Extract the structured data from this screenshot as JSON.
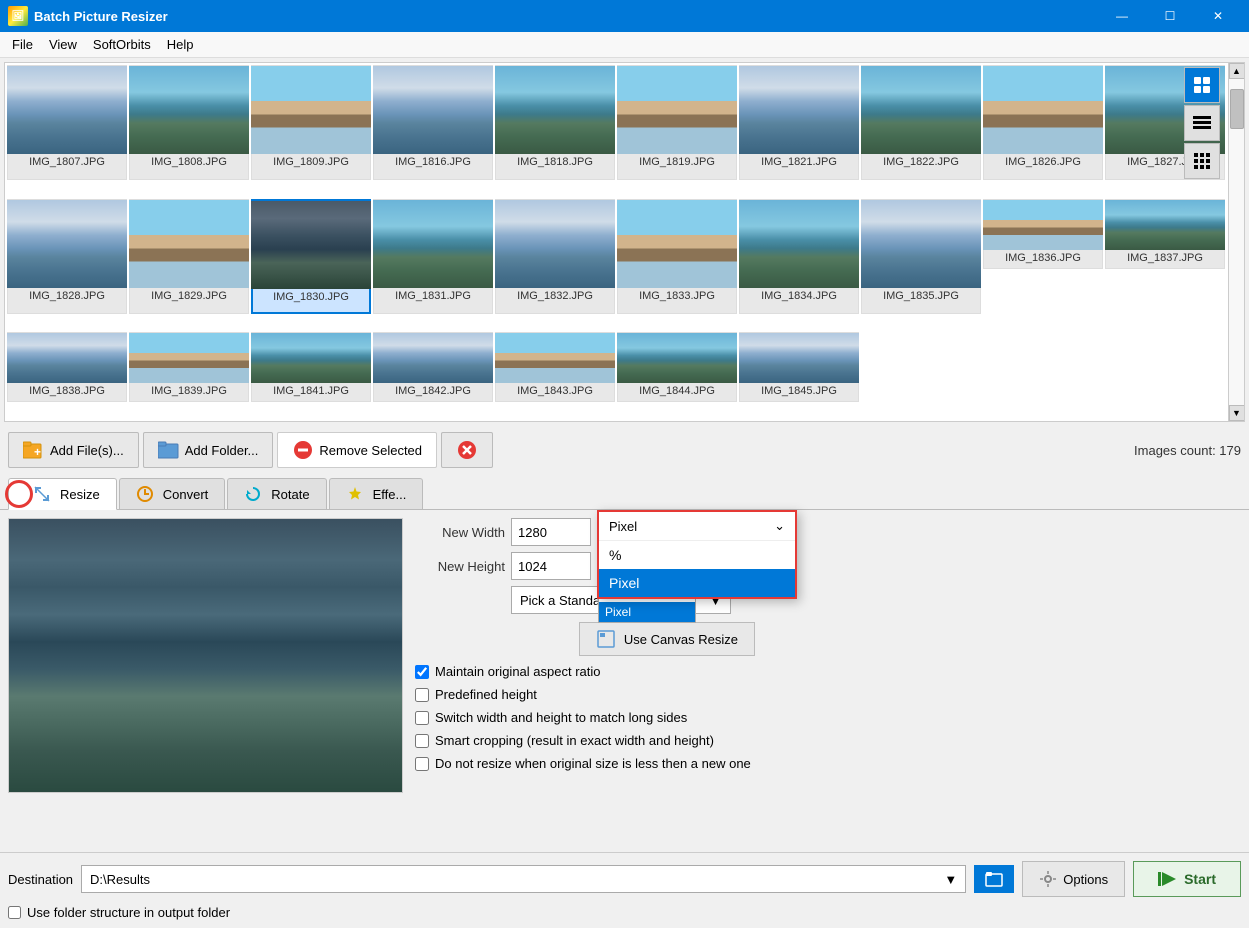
{
  "app": {
    "title": "Batch Picture Resizer",
    "icon": "🖼"
  },
  "titlebar": {
    "minimize": "—",
    "maximize": "☐",
    "close": "✕"
  },
  "menubar": {
    "items": [
      "File",
      "View",
      "SoftOrbits",
      "Help"
    ]
  },
  "toolbar": {
    "add_files_label": "Add File(s)...",
    "add_folder_label": "Add Folder...",
    "remove_selected_label": "Remove Selected",
    "images_count_label": "Images count: 179"
  },
  "tabs": {
    "resize_label": "Resize",
    "convert_label": "Convert",
    "rotate_label": "Rotate",
    "effects_label": "Effe..."
  },
  "resize": {
    "new_width_label": "New Width",
    "new_height_label": "New Height",
    "width_value": "1280",
    "height_value": "1024",
    "unit_options": [
      "%",
      "Pixel"
    ],
    "unit_selected": "Pixel",
    "standard_size_placeholder": "Pick a Standard Size",
    "maintain_aspect_label": "Maintain original aspect ratio",
    "maintain_aspect_checked": true,
    "predefined_height_label": "Predefined height",
    "predefined_height_checked": false,
    "switch_wh_label": "Switch width and height to match long sides",
    "switch_wh_checked": false,
    "smart_crop_label": "Smart cropping (result in exact width and height)",
    "smart_crop_checked": false,
    "no_resize_label": "Do not resize when original size is less then a new one",
    "no_resize_checked": false,
    "canvas_btn_label": "Use Canvas Resize"
  },
  "dropdown_popup": {
    "header": "Pixel",
    "options": [
      {
        "label": "%",
        "selected": false
      },
      {
        "label": "Pixel",
        "selected": true
      }
    ]
  },
  "bottom": {
    "destination_label": "Destination",
    "destination_value": "D:\\Results",
    "options_label": "Options",
    "start_label": "Start",
    "folder_structure_label": "Use folder structure in output folder"
  },
  "images": [
    "IMG_1807.JPG",
    "IMG_1808.JPG",
    "IMG_1809.JPG",
    "IMG_1816.JPG",
    "IMG_1818.JPG",
    "IMG_1819.JPG",
    "IMG_1821.JPG",
    "IMG_1822.JPG",
    "IMG_1826.JPG",
    "IMG_1827.JPG",
    "IMG_1828.JPG",
    "IMG_1829.JPG",
    "IMG_1830.JPG",
    "IMG_1831.JPG",
    "IMG_1832.JPG",
    "IMG_1833.JPG",
    "IMG_1834.JPG",
    "IMG_1835.JPG",
    "IMG_1836.JPG",
    "IMG_1837.JPG",
    "IMG_1838.JPG",
    "IMG_1839.JPG",
    "IMG_1841.JPG",
    "IMG_1842.JPG",
    "IMG_1843.JPG",
    "IMG_1844.JPG",
    "IMG_1845.JPG"
  ],
  "side_panel": {
    "btn1_icon": "🖼",
    "btn2_icon": "☰",
    "btn3_icon": "⊞"
  }
}
